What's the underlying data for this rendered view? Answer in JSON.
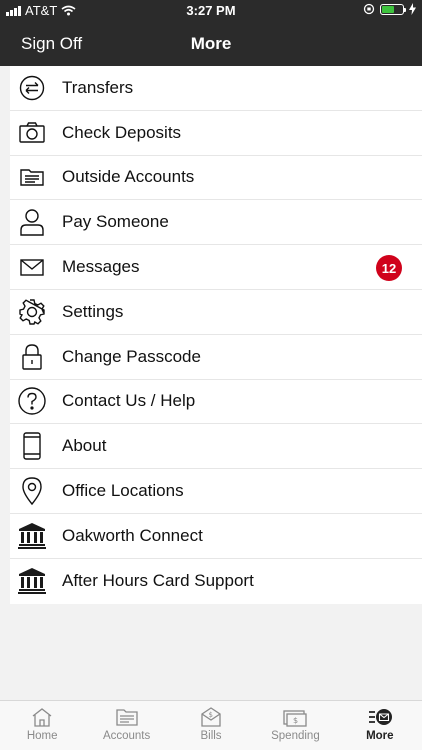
{
  "status": {
    "carrier": "AT&T",
    "time": "3:27 PM"
  },
  "nav": {
    "left": "Sign Off",
    "title": "More"
  },
  "menu": [
    {
      "label": "Transfers",
      "icon": "transfers-icon"
    },
    {
      "label": "Check Deposits",
      "icon": "camera-icon"
    },
    {
      "label": "Outside Accounts",
      "icon": "folder-icon"
    },
    {
      "label": "Pay Someone",
      "icon": "person-icon"
    },
    {
      "label": "Messages",
      "icon": "envelope-icon",
      "badge": "12"
    },
    {
      "label": "Settings",
      "icon": "gear-icon"
    },
    {
      "label": "Change Passcode",
      "icon": "lock-icon"
    },
    {
      "label": "Contact Us / Help",
      "icon": "question-icon"
    },
    {
      "label": "About",
      "icon": "phone-icon"
    },
    {
      "label": "Office Locations",
      "icon": "location-pin-icon"
    },
    {
      "label": "Oakworth Connect",
      "icon": "bank-icon"
    },
    {
      "label": "After Hours Card Support",
      "icon": "bank-icon"
    }
  ],
  "tabs": [
    {
      "label": "Home",
      "icon": "home-icon"
    },
    {
      "label": "Accounts",
      "icon": "accounts-icon"
    },
    {
      "label": "Bills",
      "icon": "bills-icon"
    },
    {
      "label": "Spending",
      "icon": "spending-icon"
    },
    {
      "label": "More",
      "icon": "more-icon",
      "active": true
    }
  ],
  "colors": {
    "bar": "#2b2b2b",
    "badge": "#d0021b",
    "battery": "#3ec33e"
  }
}
